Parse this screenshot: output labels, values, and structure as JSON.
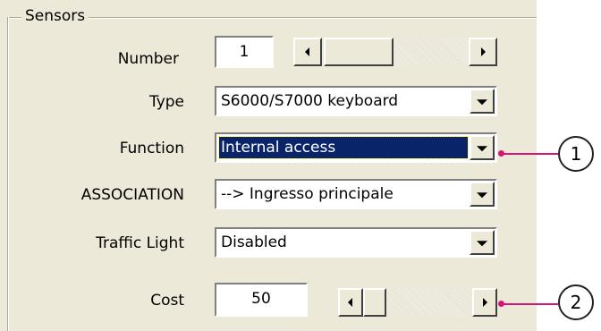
{
  "group": {
    "title": "Sensors"
  },
  "number": {
    "label": "Number",
    "value": "1"
  },
  "type": {
    "label": "Type",
    "selected": "S6000/S7000 keyboard"
  },
  "function": {
    "label": "Function",
    "selected": "Internal access"
  },
  "association": {
    "label": "ASSOCIATION",
    "selected": "--> Ingresso principale"
  },
  "traffic_light": {
    "label": "Traffic Light",
    "selected": "Disabled"
  },
  "cost": {
    "label": "Cost",
    "value": "50"
  },
  "callouts": [
    "1",
    "2"
  ],
  "colors": {
    "callout": "#d4157a",
    "selection": "#0a246a",
    "panel": "#ece9d8"
  }
}
